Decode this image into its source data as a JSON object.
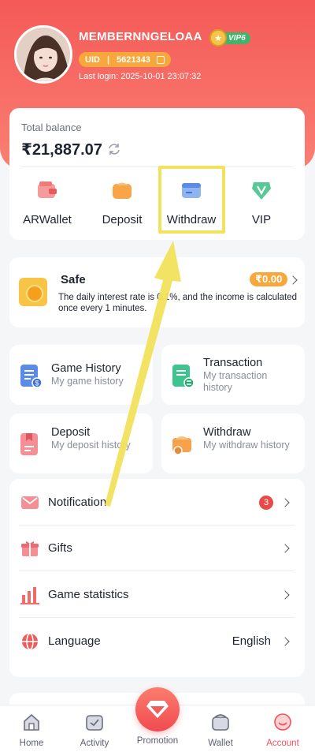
{
  "profile": {
    "username": "MEMBERNNGELOAA",
    "vip_level": "VIP6",
    "uid_label": "UID",
    "uid": "5621343",
    "last_login": "Last login: 2025-10-01 23:07:32"
  },
  "balance": {
    "label": "Total balance",
    "amount": "₹21,887.07",
    "actions": [
      {
        "label": "ARWallet",
        "icon": "arwallet-icon"
      },
      {
        "label": "Deposit",
        "icon": "deposit-icon"
      },
      {
        "label": "Withdraw",
        "icon": "withdraw-icon"
      },
      {
        "label": "VIP",
        "icon": "vip-icon"
      }
    ]
  },
  "safe": {
    "title": "Safe",
    "amount": "₹0.00",
    "description": "The daily interest rate is 0.1%, and the income is calculated once every 1 minutes."
  },
  "records": {
    "game_history": {
      "title": "Game History",
      "subtitle": "My game history"
    },
    "transaction": {
      "title": "Transaction",
      "subtitle": "My transaction history"
    },
    "deposit": {
      "title": "Deposit",
      "subtitle": "My deposit history"
    },
    "withdraw": {
      "title": "Withdraw",
      "subtitle": "My withdraw history"
    }
  },
  "menu": {
    "notification": {
      "label": "Notification",
      "badge": "3"
    },
    "gifts": {
      "label": "Gifts"
    },
    "game_statistics": {
      "label": "Game statistics"
    },
    "language": {
      "label": "Language",
      "value": "English"
    }
  },
  "tabbar": {
    "home": "Home",
    "activity": "Activity",
    "promotion": "Promotion",
    "wallet": "Wallet",
    "account": "Account",
    "active": "Account"
  },
  "colors": {
    "brand": "#f45a57",
    "accent_orange": "#f8a83a",
    "highlight_annotation": "#f2e25c",
    "active_tab": "#f0525a"
  }
}
